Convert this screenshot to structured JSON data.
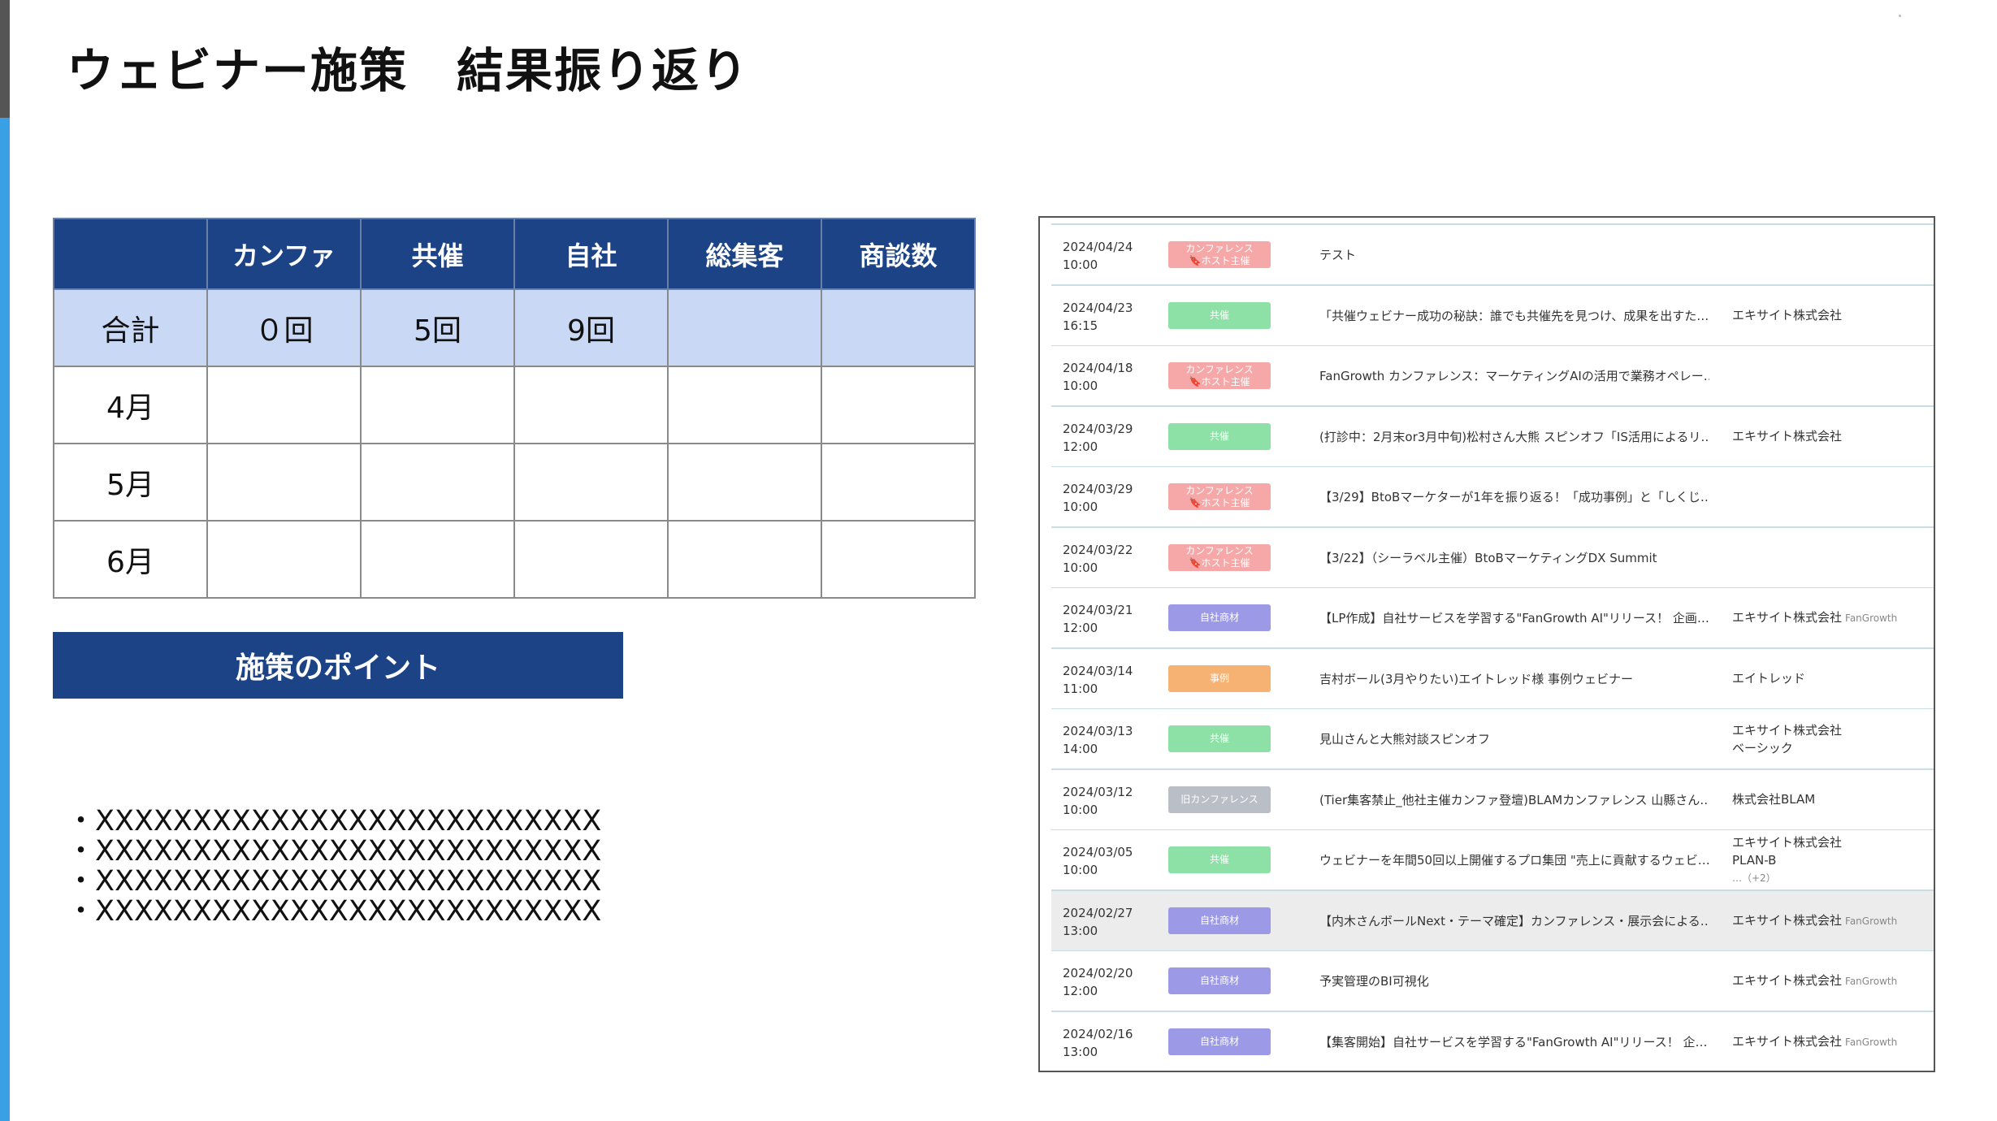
{
  "title": "ウェビナー施策　結果振り返り",
  "table": {
    "headers": [
      "",
      "カンファ",
      "共催",
      "自社",
      "総集客",
      "商談数"
    ],
    "total": [
      "合計",
      "０回",
      "5回",
      "9回",
      "",
      ""
    ],
    "months": [
      [
        "4月",
        "",
        "",
        "",
        "",
        ""
      ],
      [
        "5月",
        "",
        "",
        "",
        "",
        ""
      ],
      [
        "6月",
        "",
        "",
        "",
        "",
        ""
      ]
    ]
  },
  "point_header": "施策のポイント",
  "points": [
    "・XXXXXXXXXXXXXXXXXXXXXXXXXX",
    "・XXXXXXXXXXXXXXXXXXXXXXXXXX",
    "・XXXXXXXXXXXXXXXXXXXXXXXXXX",
    "・XXXXXXXXXXXXXXXXXXXXXXXXXX"
  ],
  "colors": {
    "navy": "#1c4386",
    "light_blue": "#c9d9f5",
    "accent": "#3aa0e6",
    "tag_conference": "#f6a8a8",
    "tag_cohost": "#8de0a6",
    "tag_own": "#9c9ae6",
    "tag_case": "#f5b272",
    "tag_old": "#b9bec7"
  },
  "events": [
    {
      "date": "2024/04/24",
      "time": "10:00",
      "tag": [
        "カンファレンス",
        "🔖ホスト主催"
      ],
      "tag_color": "#f6a8a8",
      "title": "テスト",
      "company": [],
      "brand": ""
    },
    {
      "date": "2024/04/23",
      "time": "16:15",
      "tag": [
        "共催"
      ],
      "tag_color": "#8de0a6",
      "title": "「共催ウェビナー成功の秘訣：誰でも共催先を見つけ、成果を出すた…",
      "company": [
        "エキサイト株式会社"
      ],
      "brand": ""
    },
    {
      "date": "2024/04/18",
      "time": "10:00",
      "tag": [
        "カンファレンス",
        "🔖ホスト主催"
      ],
      "tag_color": "#f6a8a8",
      "title": "FanGrowth カンファレンス：マーケティングAIの活用で業務オペレー…",
      "company": [],
      "brand": ""
    },
    {
      "date": "2024/03/29",
      "time": "12:00",
      "tag": [
        "共催"
      ],
      "tag_color": "#8de0a6",
      "title": "(打診中：2月末or3月中旬)松村さん大熊 スピンオフ「IS活用によるリ…",
      "company": [
        "エキサイト株式会社"
      ],
      "brand": ""
    },
    {
      "date": "2024/03/29",
      "time": "10:00",
      "tag": [
        "カンファレンス",
        "🔖ホスト主催"
      ],
      "tag_color": "#f6a8a8",
      "title": "【3/29】BtoBマーケターが1年を振り返る！「成功事例」と「しくじ…",
      "company": [],
      "brand": ""
    },
    {
      "date": "2024/03/22",
      "time": "10:00",
      "tag": [
        "カンファレンス",
        "🔖ホスト主催"
      ],
      "tag_color": "#f6a8a8",
      "title": "【3/22】（シーラベル主催）BtoBマーケティングDX Summit",
      "company": [],
      "brand": ""
    },
    {
      "date": "2024/03/21",
      "time": "12:00",
      "tag": [
        "自社商材"
      ],
      "tag_color": "#9c9ae6",
      "title": "【LP作成】自社サービスを学習する\"FanGrowth AI\"リリース！ 企画…",
      "company": [
        "エキサイト株式会社"
      ],
      "brand": "FanGrowth"
    },
    {
      "date": "2024/03/14",
      "time": "11:00",
      "tag": [
        "事例"
      ],
      "tag_color": "#f5b272",
      "title": "吉村ボール(3月やりたい)エイトレッド様 事例ウェビナー",
      "company": [
        "エイトレッド"
      ],
      "brand": ""
    },
    {
      "date": "2024/03/13",
      "time": "14:00",
      "tag": [
        "共催"
      ],
      "tag_color": "#8de0a6",
      "title": "見山さんと大熊対談スピンオフ",
      "company": [
        "エキサイト株式会社",
        "ベーシック"
      ],
      "brand": ""
    },
    {
      "date": "2024/03/12",
      "time": "10:00",
      "tag": [
        "旧カンファレンス"
      ],
      "tag_color": "#b9bec7",
      "title": "(Tier集客禁止_他社主催カンファ登壇)BLAMカンファレンス 山縣さん…",
      "company": [
        "株式会社BLAM"
      ],
      "brand": ""
    },
    {
      "date": "2024/03/05",
      "time": "10:00",
      "tag": [
        "共催"
      ],
      "tag_color": "#8de0a6",
      "title": "ウェビナーを年間50回以上開催するプロ集団 \"売上に貢献するウェビ…",
      "company": [
        "エキサイト株式会社",
        "PLAN-B"
      ],
      "extra": "…（+2）",
      "brand": ""
    },
    {
      "date": "2024/02/27",
      "time": "13:00",
      "tag": [
        "自社商材"
      ],
      "tag_color": "#9c9ae6",
      "title": "【内木さんボールNext・テーマ確定】カンファレンス・展示会による…",
      "company": [
        "エキサイト株式会社"
      ],
      "brand": "FanGrowth"
    },
    {
      "date": "2024/02/20",
      "time": "12:00",
      "tag": [
        "自社商材"
      ],
      "tag_color": "#9c9ae6",
      "title": "予実管理のBI可視化",
      "company": [
        "エキサイト株式会社"
      ],
      "brand": "FanGrowth"
    },
    {
      "date": "2024/02/16",
      "time": "13:00",
      "tag": [
        "自社商材"
      ],
      "tag_color": "#9c9ae6",
      "title": "【集客開始】自社サービスを学習する\"FanGrowth AI\"リリース！ 企…",
      "company": [
        "エキサイト株式会社"
      ],
      "brand": "FanGrowth"
    }
  ]
}
